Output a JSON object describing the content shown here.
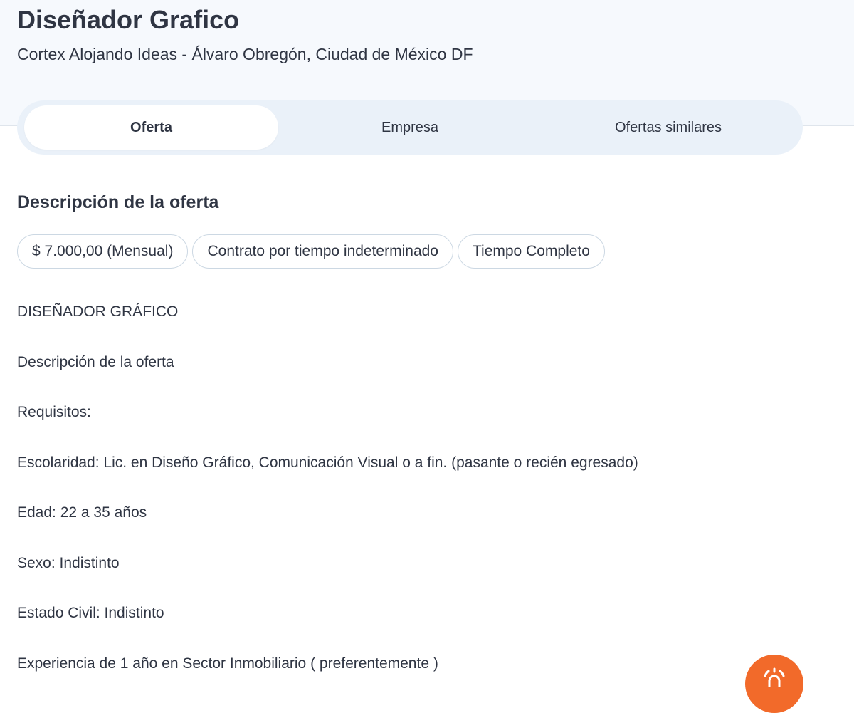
{
  "header": {
    "title": "Diseñador Grafico",
    "company_location": "Cortex Alojando Ideas - Álvaro Obregón, Ciudad de México DF"
  },
  "tabs": [
    {
      "label": "Oferta",
      "active": true
    },
    {
      "label": "Empresa",
      "active": false
    },
    {
      "label": "Ofertas similares",
      "active": false
    }
  ],
  "section": {
    "title": "Descripción de la oferta"
  },
  "chips": [
    "$ 7.000,00 (Mensual)",
    "Contrato por tiempo indeterminado",
    "Tiempo Completo"
  ],
  "description": [
    "DISEÑADOR GRÁFICO",
    "Descripción de la oferta",
    "Requisitos:",
    "Escolaridad: Lic. en Diseño Gráfico, Comunicación Visual o a fin. (pasante o recién egresado)",
    "Edad: 22 a 35 años",
    "Sexo: Indistinto",
    "Estado Civil: Indistinto",
    "Experiencia de 1 año en Sector Inmobiliario ( preferentemente )"
  ],
  "fab": {
    "icon": "alarm-bell-icon",
    "color": "#f26a2a"
  },
  "colors": {
    "text": "#2f3543",
    "header_bg": "#f6f9fd",
    "tabs_bg": "#eaf1f9",
    "accent": "#f26a2a"
  }
}
